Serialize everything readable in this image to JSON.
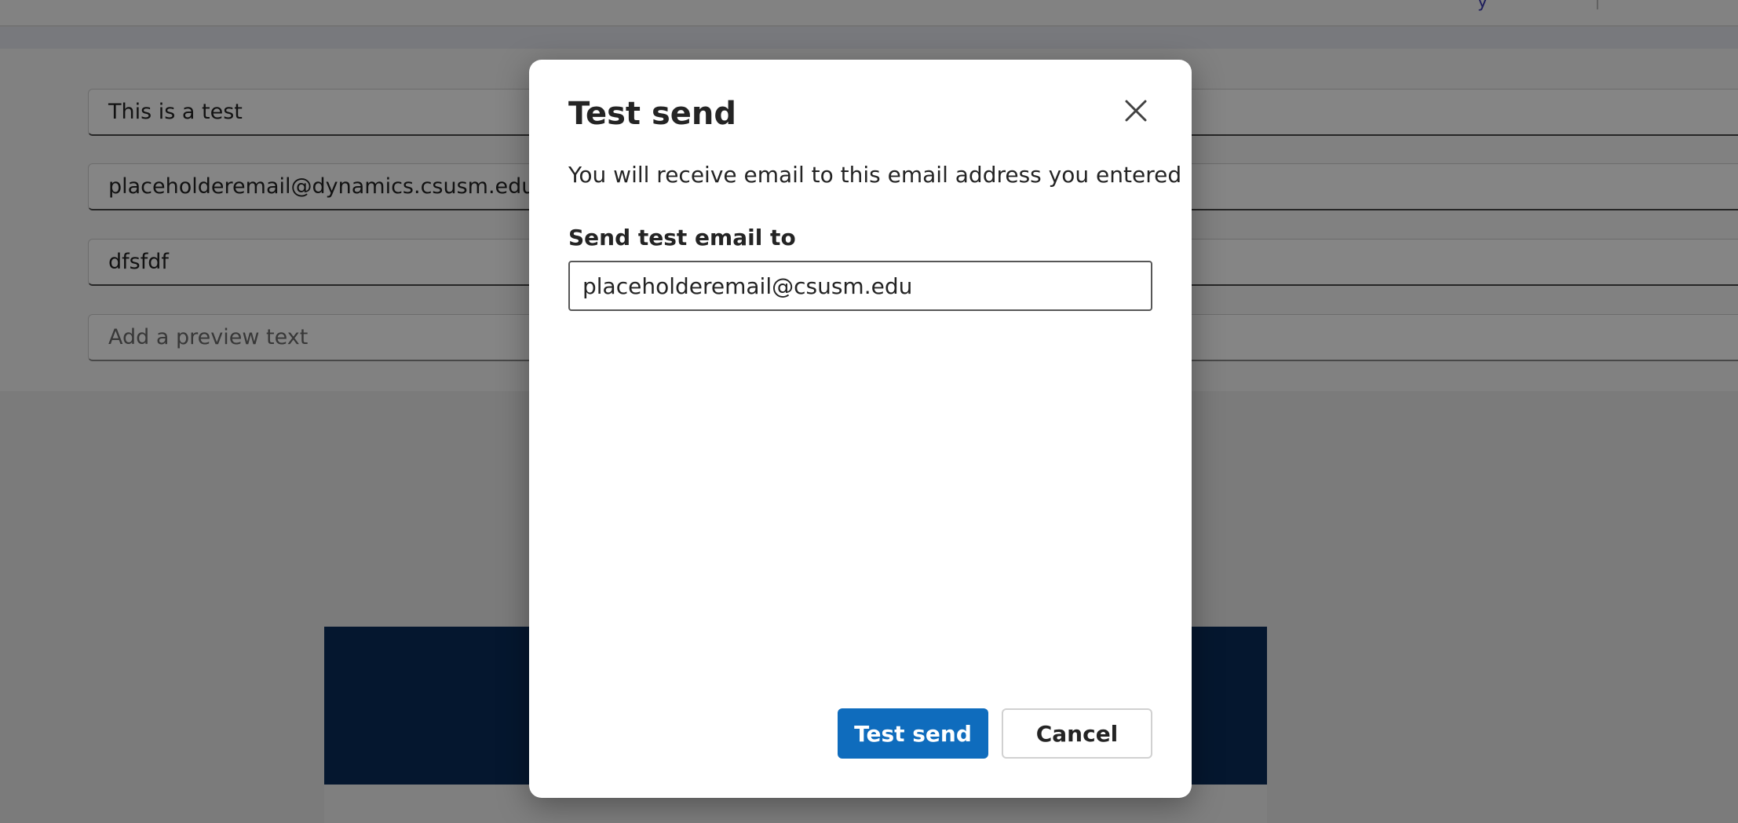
{
  "background": {
    "top_link_text": "y",
    "fields": {
      "subject": "This is a test",
      "from_email": "placeholderemail@dynamics.csusm.edu",
      "from_name": "dfsfdf",
      "preview_placeholder": "Add a preview text"
    },
    "banner_color": "#0b2d5a"
  },
  "dialog": {
    "title": "Test send",
    "description": "You will receive email to this email address you entered",
    "field_label": "Send test email to",
    "email_value": "placeholderemail@csusm.edu",
    "primary_button": "Test send",
    "secondary_button": "Cancel",
    "close_icon": "close-icon",
    "accent_color": "#0f6cbd"
  }
}
